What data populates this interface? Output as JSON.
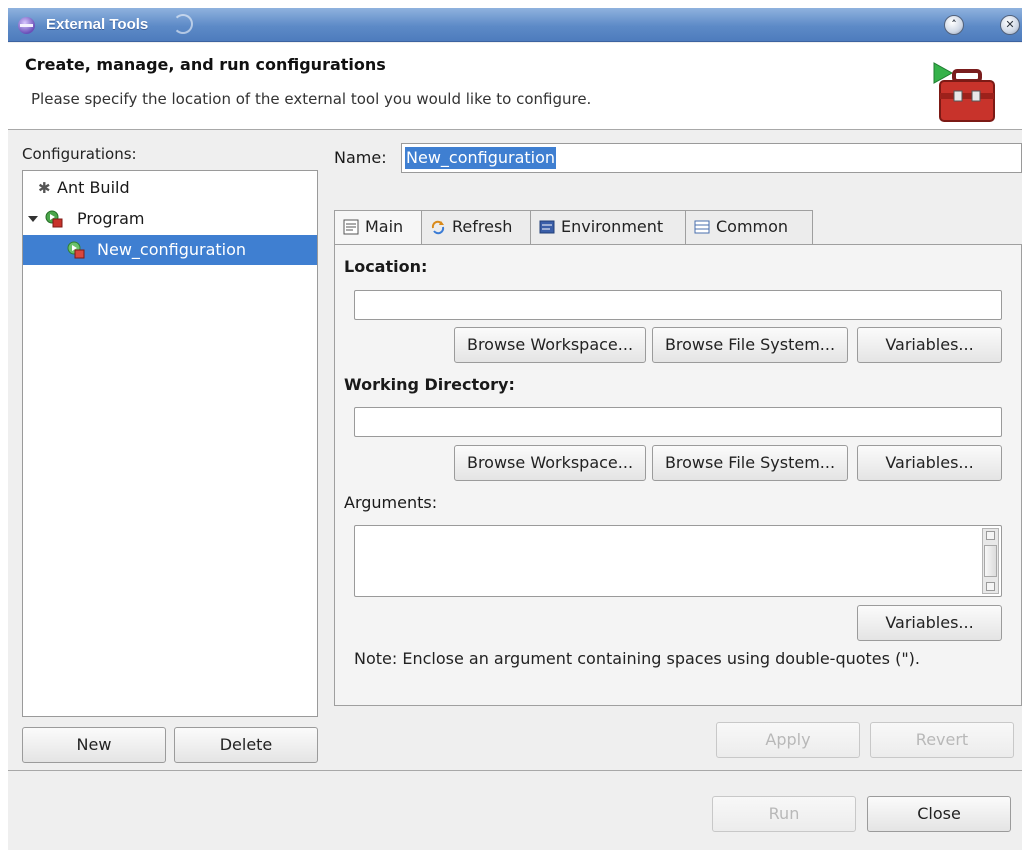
{
  "window": {
    "title": "External Tools"
  },
  "header": {
    "title": "Create, manage, and run configurations",
    "message": "Please specify the location of the external tool you would like to configure."
  },
  "left": {
    "configurations_label": "Configurations:",
    "tree": [
      {
        "label": "Ant Build",
        "icon": "ant-icon"
      },
      {
        "label": "Program",
        "icon": "program-icon",
        "expanded": true
      },
      {
        "label": "New_configuration",
        "icon": "configuration-icon",
        "selected": true
      }
    ],
    "new_label": "New",
    "delete_label": "Delete"
  },
  "main": {
    "name_label": "Name:",
    "name_value": "New_configuration",
    "tabs": [
      {
        "label": "Main",
        "icon": "main-tab-icon",
        "active": true
      },
      {
        "label": "Refresh",
        "icon": "refresh-icon"
      },
      {
        "label": "Environment",
        "icon": "environment-icon"
      },
      {
        "label": "Common",
        "icon": "common-icon"
      }
    ],
    "location_label": "Location:",
    "location_value": "",
    "working_dir_label": "Working Directory:",
    "working_dir_value": "",
    "arguments_label": "Arguments:",
    "arguments_value": "",
    "browse_workspace_label": "Browse Workspace...",
    "browse_filesystem_label": "Browse File System...",
    "variables_label": "Variables...",
    "note": "Note: Enclose an argument containing spaces using double-quotes (\")."
  },
  "actions": {
    "apply_label": "Apply",
    "revert_label": "Revert",
    "run_label": "Run",
    "close_label": "Close"
  },
  "colors": {
    "titlebar": "#5d8ac7",
    "selection": "#3f7fd1",
    "window_bg": "#efefef"
  }
}
